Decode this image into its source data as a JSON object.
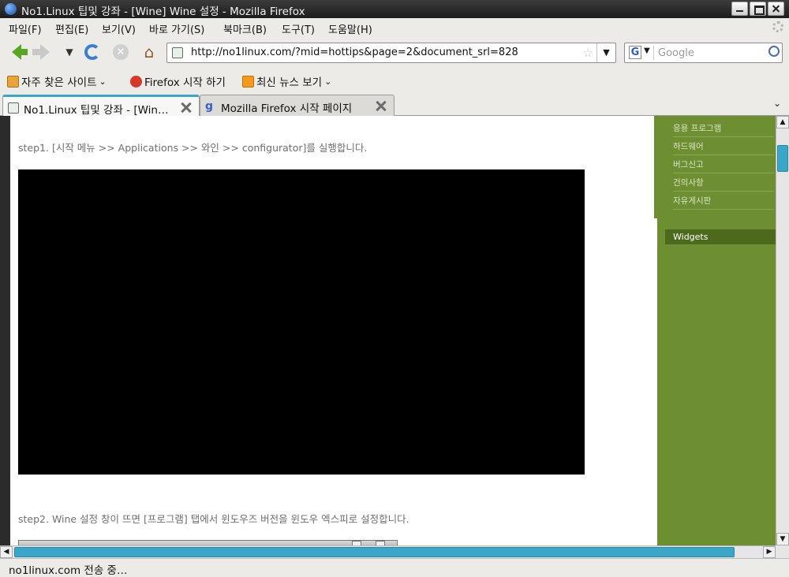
{
  "window": {
    "title": "No1.Linux 팁및 강좌 - [Wine] Wine 설정 - Mozilla Firefox"
  },
  "menu": [
    "파일(F)",
    "편집(E)",
    "보기(V)",
    "바로 가기(S)",
    "북마크(B)",
    "도구(T)",
    "도움말(H)"
  ],
  "nav": {
    "url": "http://no1linux.com/?mid=hottips&page=2&document_srl=828",
    "search_placeholder": "Google",
    "search_engine_letter": "G"
  },
  "bookmarks": [
    "자주 찾은 사이트",
    "Firefox 시작 하기",
    "최신 뉴스 보기"
  ],
  "tabs": [
    {
      "label": "No1.Linux 팁및 강좌 - [Win…",
      "active": true
    },
    {
      "label": "Mozilla Firefox 시작 페이지",
      "active": false
    }
  ],
  "content": {
    "step1": "step1. [시작 메뉴 >> Applications >> 와인 >> configurator]를 실행합니다.",
    "step2": "step2. Wine 설정 창이 뜨면 [프로그램] 탭에서 윈도우즈 버전을 윈도우 엑스피로 설정합니다."
  },
  "sidebar": {
    "items": [
      "응용 프로그램",
      "하드웨어",
      "버그신고",
      "건의사항",
      "자유게시판"
    ],
    "widgets_label": "Widgets"
  },
  "status": {
    "text": "no1linux.com 전송 중…"
  },
  "colors": {
    "sidebar_green": "#6e8e32",
    "accent_teal": "#3ba7c8"
  }
}
